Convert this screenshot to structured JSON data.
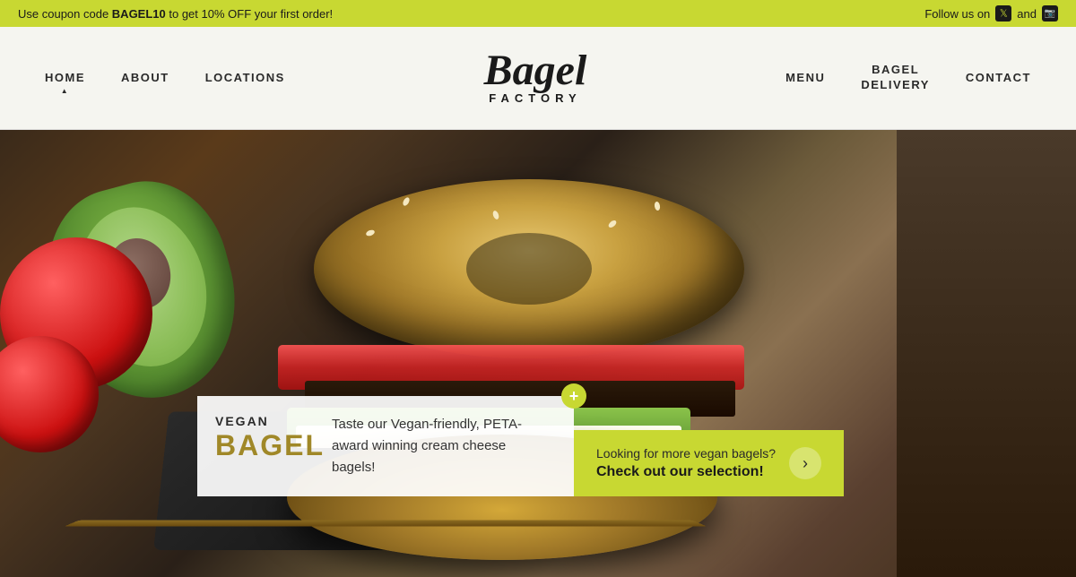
{
  "banner": {
    "coupon_text": "Use coupon code ",
    "coupon_code": "BAGEL10",
    "coupon_suffix": " to get 10% OFF your first order!",
    "social_prefix": "Follow us on",
    "social_connector": "and"
  },
  "nav": {
    "logo_main": "Bagel",
    "logo_sub": "FACTORY",
    "items": [
      {
        "label": "HOME",
        "active": true
      },
      {
        "label": "ABOUT",
        "active": false
      },
      {
        "label": "LOCATIONS",
        "active": false
      },
      {
        "label": "MENU",
        "active": false
      },
      {
        "label": "BAGEL\nDELIVERY",
        "active": false
      },
      {
        "label": "CONTACT",
        "active": false
      }
    ]
  },
  "hero": {
    "info_box": {
      "vegan_label": "VEGAN",
      "bagel_label": "BAGEL",
      "description": "Taste our Vegan-friendly, PETA-award winning cream cheese bagels!",
      "plus_label": "+"
    },
    "cta": {
      "line1": "Looking for more vegan bagels?",
      "line2": "Check out our selection!",
      "arrow": "›"
    }
  }
}
